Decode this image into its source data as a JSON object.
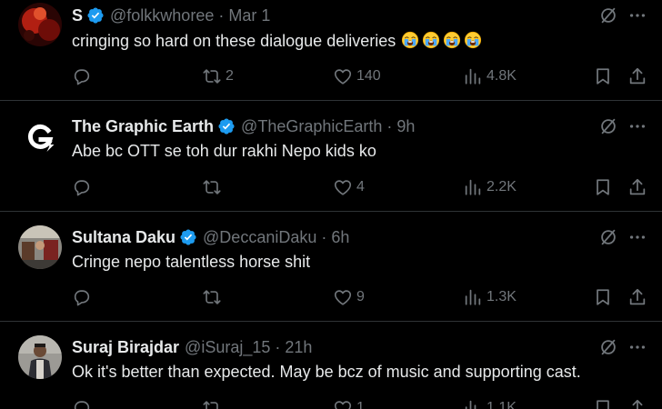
{
  "tweets": [
    {
      "name": "S",
      "handle": "@folkkwhoree",
      "time": "Mar 1",
      "text": "cringing so hard on these dialogue deliveries",
      "emoji_count": 4,
      "replies": "",
      "retweets": "2",
      "likes": "140",
      "views": "4.8K",
      "avatar": "dark-red-avatar"
    },
    {
      "name": "The Graphic Earth",
      "handle": "@TheGraphicEarth",
      "time": "9h",
      "text": "Abe bc OTT se toh dur rakhi Nepo kids ko",
      "replies": "",
      "retweets": "",
      "likes": "4",
      "views": "2.2K",
      "avatar": "g-logo-avatar"
    },
    {
      "name": "Sultana Daku",
      "handle": "@DeccaniDaku",
      "time": "6h",
      "text": "Cringe nepo talentless horse shit",
      "replies": "",
      "retweets": "",
      "likes": "9",
      "views": "1.3K",
      "avatar": "photo-avatar"
    },
    {
      "name": "Suraj Birajdar",
      "handle": "@iSuraj_15",
      "time": "21h",
      "text": "Ok it's better than expected. May be bcz of music and supporting cast.",
      "replies": "",
      "retweets": "",
      "likes": "1",
      "views": "1.1K",
      "avatar": "person-avatar"
    }
  ],
  "separator": "·",
  "colors": {
    "background": "#000000",
    "text": "#e7e9ea",
    "muted": "#71767b",
    "verified": "#1d9bf0",
    "divider": "#2f3336"
  },
  "icons": [
    "verified-badge-icon",
    "grok-icon",
    "more-icon",
    "reply-icon",
    "retweet-icon",
    "like-icon",
    "views-icon",
    "bookmark-icon",
    "share-icon",
    "loudly-crying-face-emoji"
  ]
}
